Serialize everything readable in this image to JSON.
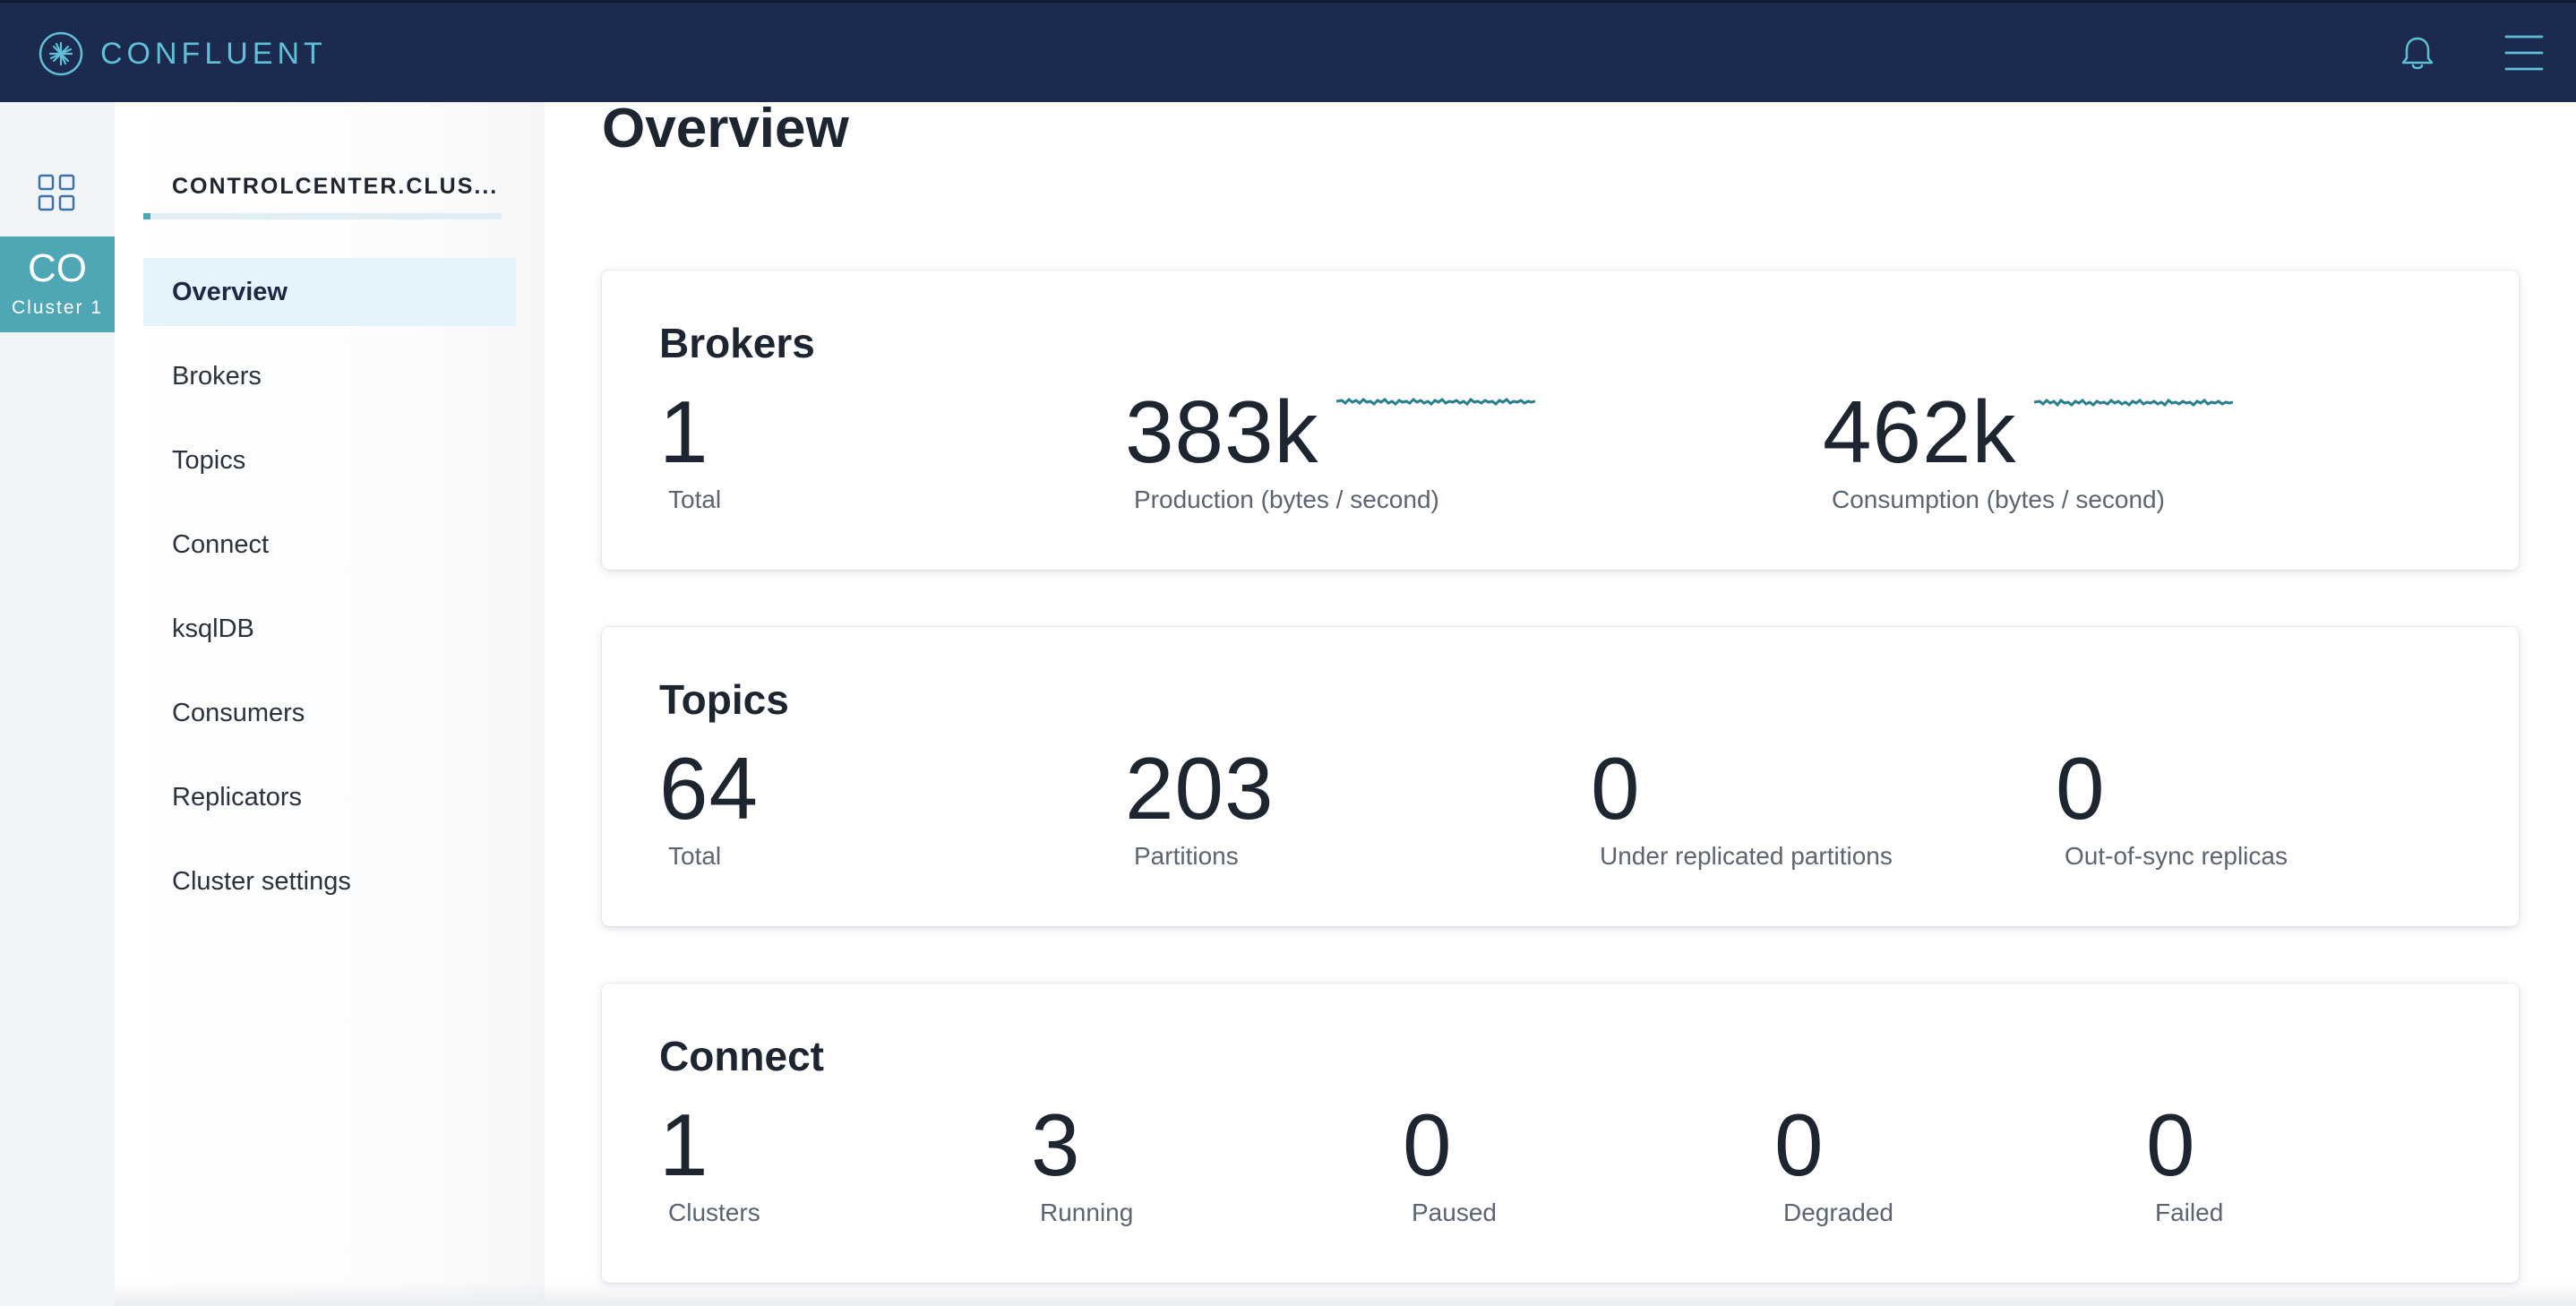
{
  "header": {
    "brand": "CONFLUENT"
  },
  "rail": {
    "cluster_abbr": "CO",
    "cluster_name": "Cluster 1"
  },
  "sidebar": {
    "cluster_title": "CONTROLCENTER.CLUS...",
    "items": [
      {
        "label": "Overview",
        "active": true
      },
      {
        "label": "Brokers"
      },
      {
        "label": "Topics"
      },
      {
        "label": "Connect"
      },
      {
        "label": "ksqlDB"
      },
      {
        "label": "Consumers"
      },
      {
        "label": "Replicators"
      },
      {
        "label": "Cluster settings"
      }
    ]
  },
  "main": {
    "title": "Overview",
    "brokers": {
      "title": "Brokers",
      "total": {
        "value": "1",
        "label": "Total"
      },
      "production": {
        "value": "383k",
        "label": "Production (bytes / second)"
      },
      "consumption": {
        "value": "462k",
        "label": "Consumption (bytes / second)"
      }
    },
    "topics": {
      "title": "Topics",
      "total": {
        "value": "64",
        "label": "Total"
      },
      "partitions": {
        "value": "203",
        "label": "Partitions"
      },
      "under_replicated": {
        "value": "0",
        "label": "Under replicated partitions"
      },
      "out_of_sync": {
        "value": "0",
        "label": "Out-of-sync replicas"
      }
    },
    "connect": {
      "title": "Connect",
      "clusters": {
        "value": "1",
        "label": "Clusters"
      },
      "running": {
        "value": "3",
        "label": "Running"
      },
      "paused": {
        "value": "0",
        "label": "Paused"
      },
      "degraded": {
        "value": "0",
        "label": "Degraded"
      },
      "failed": {
        "value": "0",
        "label": "Failed"
      }
    }
  },
  "colors": {
    "topbar": "#1b2a4e",
    "brand_text": "#5fbfd6",
    "accent": "#4fa7b5",
    "active_nav": "#e3f4fa",
    "sparkline": "#2a7f8f"
  }
}
